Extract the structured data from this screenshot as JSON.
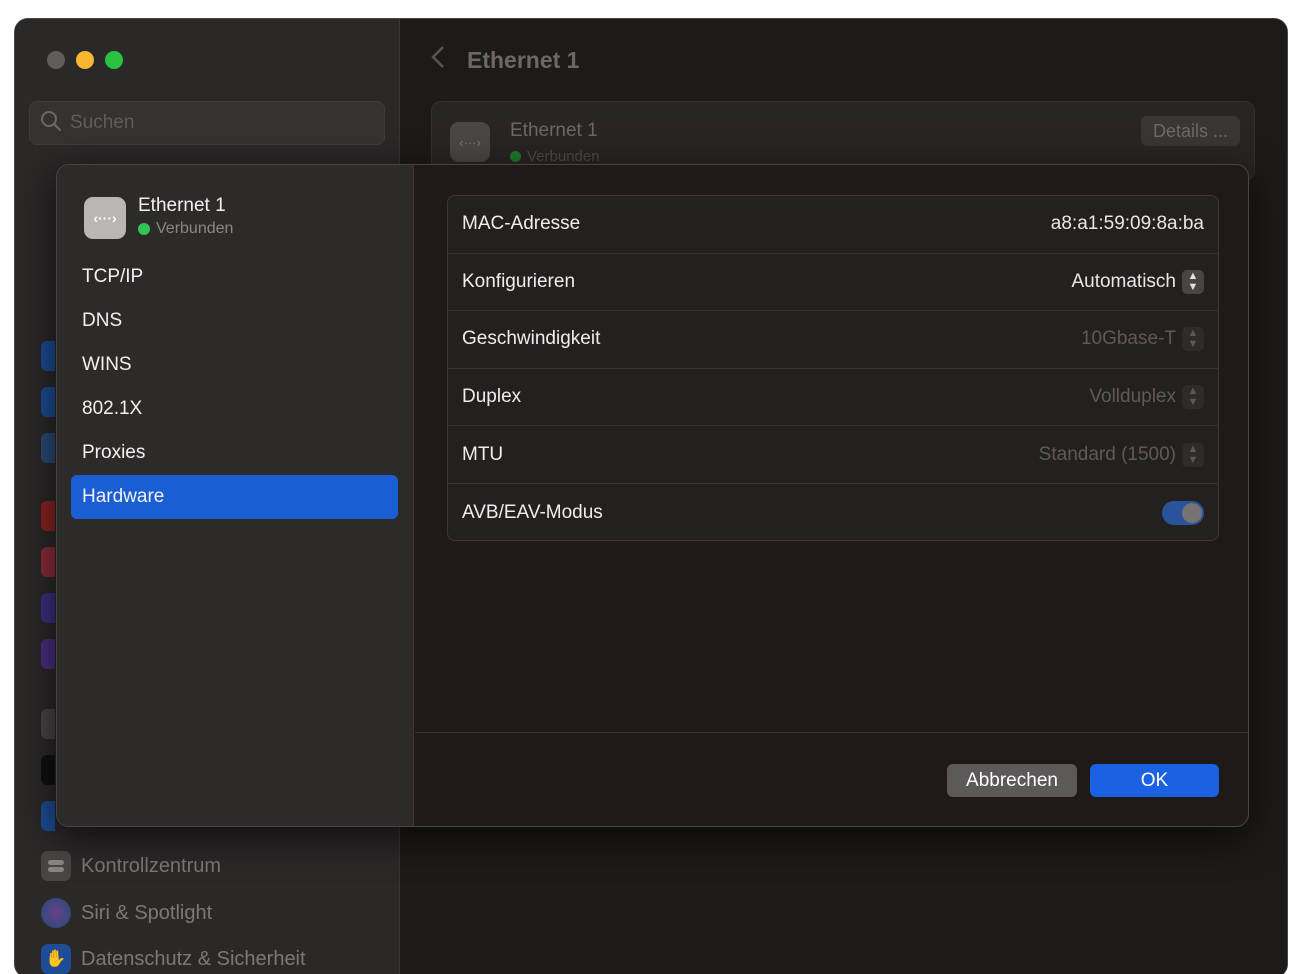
{
  "background": {
    "search_placeholder": "Suchen",
    "header_title": "Ethernet 1",
    "card": {
      "title": "Ethernet 1",
      "status": "Verbunden",
      "details_button": "Details ..."
    },
    "sidebar_items": [
      {
        "label": "Kontrollzentrum",
        "icon": "control-center-icon"
      },
      {
        "label": "Siri & Spotlight",
        "icon": "siri-icon"
      },
      {
        "label": "Datenschutz & Sicherheit",
        "icon": "hand-icon"
      }
    ]
  },
  "sheet": {
    "interface": {
      "name": "Ethernet 1",
      "status": "Verbunden",
      "icon": "ethernet-icon"
    },
    "tabs": [
      {
        "label": "TCP/IP"
      },
      {
        "label": "DNS"
      },
      {
        "label": "WINS"
      },
      {
        "label": "802.1X"
      },
      {
        "label": "Proxies"
      },
      {
        "label": "Hardware",
        "active": true
      }
    ],
    "properties": {
      "mac": {
        "label": "MAC-Adresse",
        "value": "a8:a1:59:09:8a:ba"
      },
      "configure": {
        "label": "Konfigurieren",
        "value": "Automatisch"
      },
      "speed": {
        "label": "Geschwindigkeit",
        "value": "10Gbase-T"
      },
      "duplex": {
        "label": "Duplex",
        "value": "Vollduplex"
      },
      "mtu": {
        "label": "MTU",
        "value": "Standard (1500)"
      },
      "avb": {
        "label": "AVB/EAV-Modus",
        "enabled": true
      }
    },
    "buttons": {
      "cancel": "Abbrechen",
      "ok": "OK"
    }
  },
  "colors": {
    "accent": "#1a62e2",
    "selected_tab": "#1a5ed3",
    "status_green": "#2dc653"
  }
}
